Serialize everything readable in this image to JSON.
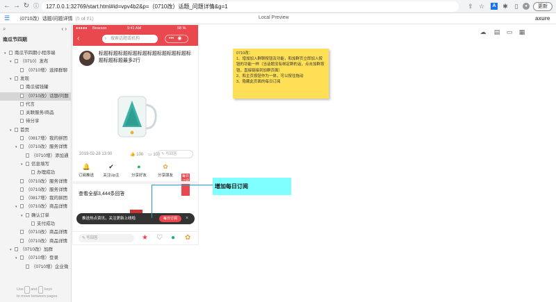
{
  "browser": {
    "url": "127.0.0.1:32769/start.html#id=vpv4b2&p=（0710改）话题_问题详情&g=1",
    "update_label": "更新"
  },
  "toolbar": {
    "page_title": "（0710改）话题/问题详情",
    "page_count": "(5 of 71)",
    "local_preview": "Local Preview",
    "logo": "axure"
  },
  "sidebar": {
    "project": "南瓜节四期",
    "items": [
      {
        "label": "南瓜节四期小程序端",
        "tw": "▾",
        "indent": 0
      },
      {
        "label": "（0710）发布",
        "tw": "▾",
        "indent": 1
      },
      {
        "label": "（0710增）选择群聊",
        "tw": "",
        "indent": 2
      },
      {
        "label": "发现",
        "tw": "▾",
        "indent": 1
      },
      {
        "label": "南瓜储钱罐",
        "tw": "",
        "indent": 2
      },
      {
        "label": "（0710改）话题/问题",
        "tw": "",
        "indent": 2,
        "selected": true
      },
      {
        "label": "代言",
        "tw": "",
        "indent": 2
      },
      {
        "label": "关联服务/商品",
        "tw": "",
        "indent": 2
      },
      {
        "label": "待分享",
        "tw": "",
        "indent": 2
      },
      {
        "label": "首页",
        "tw": "▾",
        "indent": 1
      },
      {
        "label": "（0817增）我的拼团",
        "tw": "",
        "indent": 2
      },
      {
        "label": "（0710改）服务详情",
        "tw": "▾",
        "indent": 2
      },
      {
        "label": "（0710增）添加通",
        "tw": "",
        "indent": 3
      },
      {
        "label": "信息填写",
        "tw": "▾",
        "indent": 3
      },
      {
        "label": "办理成功",
        "tw": "",
        "indent": 4
      },
      {
        "label": "（0710改）服务详情",
        "tw": "",
        "indent": 2
      },
      {
        "label": "（0710改）服务详情",
        "tw": "",
        "indent": 2
      },
      {
        "label": "（0817增）我的拼团",
        "tw": "",
        "indent": 2
      },
      {
        "label": "（0710改）商品详情",
        "tw": "▾",
        "indent": 2
      },
      {
        "label": "确认订单",
        "tw": "▾",
        "indent": 3
      },
      {
        "label": "支付成功",
        "tw": "",
        "indent": 4
      },
      {
        "label": "（0710改）商品详情",
        "tw": "",
        "indent": 2
      },
      {
        "label": "（0710改）商品详情",
        "tw": "",
        "indent": 2
      },
      {
        "label": "（0710改）加群",
        "tw": "▾",
        "indent": 1
      },
      {
        "label": "（0710增）登录",
        "tw": "▾",
        "indent": 2
      },
      {
        "label": "（0710增）企业微",
        "tw": "",
        "indent": 3
      }
    ],
    "hint_use": "Use",
    "hint_and": "and",
    "hint_keys": "keys",
    "hint_line2": "to move between pages"
  },
  "phone": {
    "carrier": "Bearson",
    "time": "9:41 AM",
    "battery": "58 %",
    "search_placeholder": "搜索话题或机构",
    "post_title": "标题标题标题标题标题标题标题标题标题标题标题标题最多2行",
    "date": "2019-02-28 13:00",
    "likes": "100",
    "comments": "100",
    "comment_placeholder": "写回答",
    "actions": [
      {
        "label": "订阅推送",
        "icon": "bell-icon"
      },
      {
        "label": "关注Up主",
        "icon": "check-circle-icon"
      },
      {
        "label": "分享好友",
        "icon": "wechat-icon"
      },
      {
        "label": "分享朋友",
        "icon": "moments-icon"
      }
    ],
    "red_tag": "每日订阅",
    "all_answers": "查看全部3,444条回答",
    "toast_text": "推送热点资讯，关注更新上线啦",
    "toast_button": "每日订阅",
    "write_placeholder": "写回答"
  },
  "sticky": {
    "lines": [
      "0710改：",
      "1、增加加入群聊按钮及功能，和加群页立即加入按钮的功能一样（当话题没有绑定群的话，点击加群按钮，直接链接到加群页面）",
      "2、和主页按钮作为一体，可以按住拖动",
      "3、隐藏此页面的每日订阅"
    ]
  },
  "callout": {
    "label": "增加每日订阅"
  },
  "colors": {
    "accent": "#e8484e",
    "sticky": "#ffdf55",
    "callout": "#7fffff",
    "link": "#1a9fd9"
  }
}
